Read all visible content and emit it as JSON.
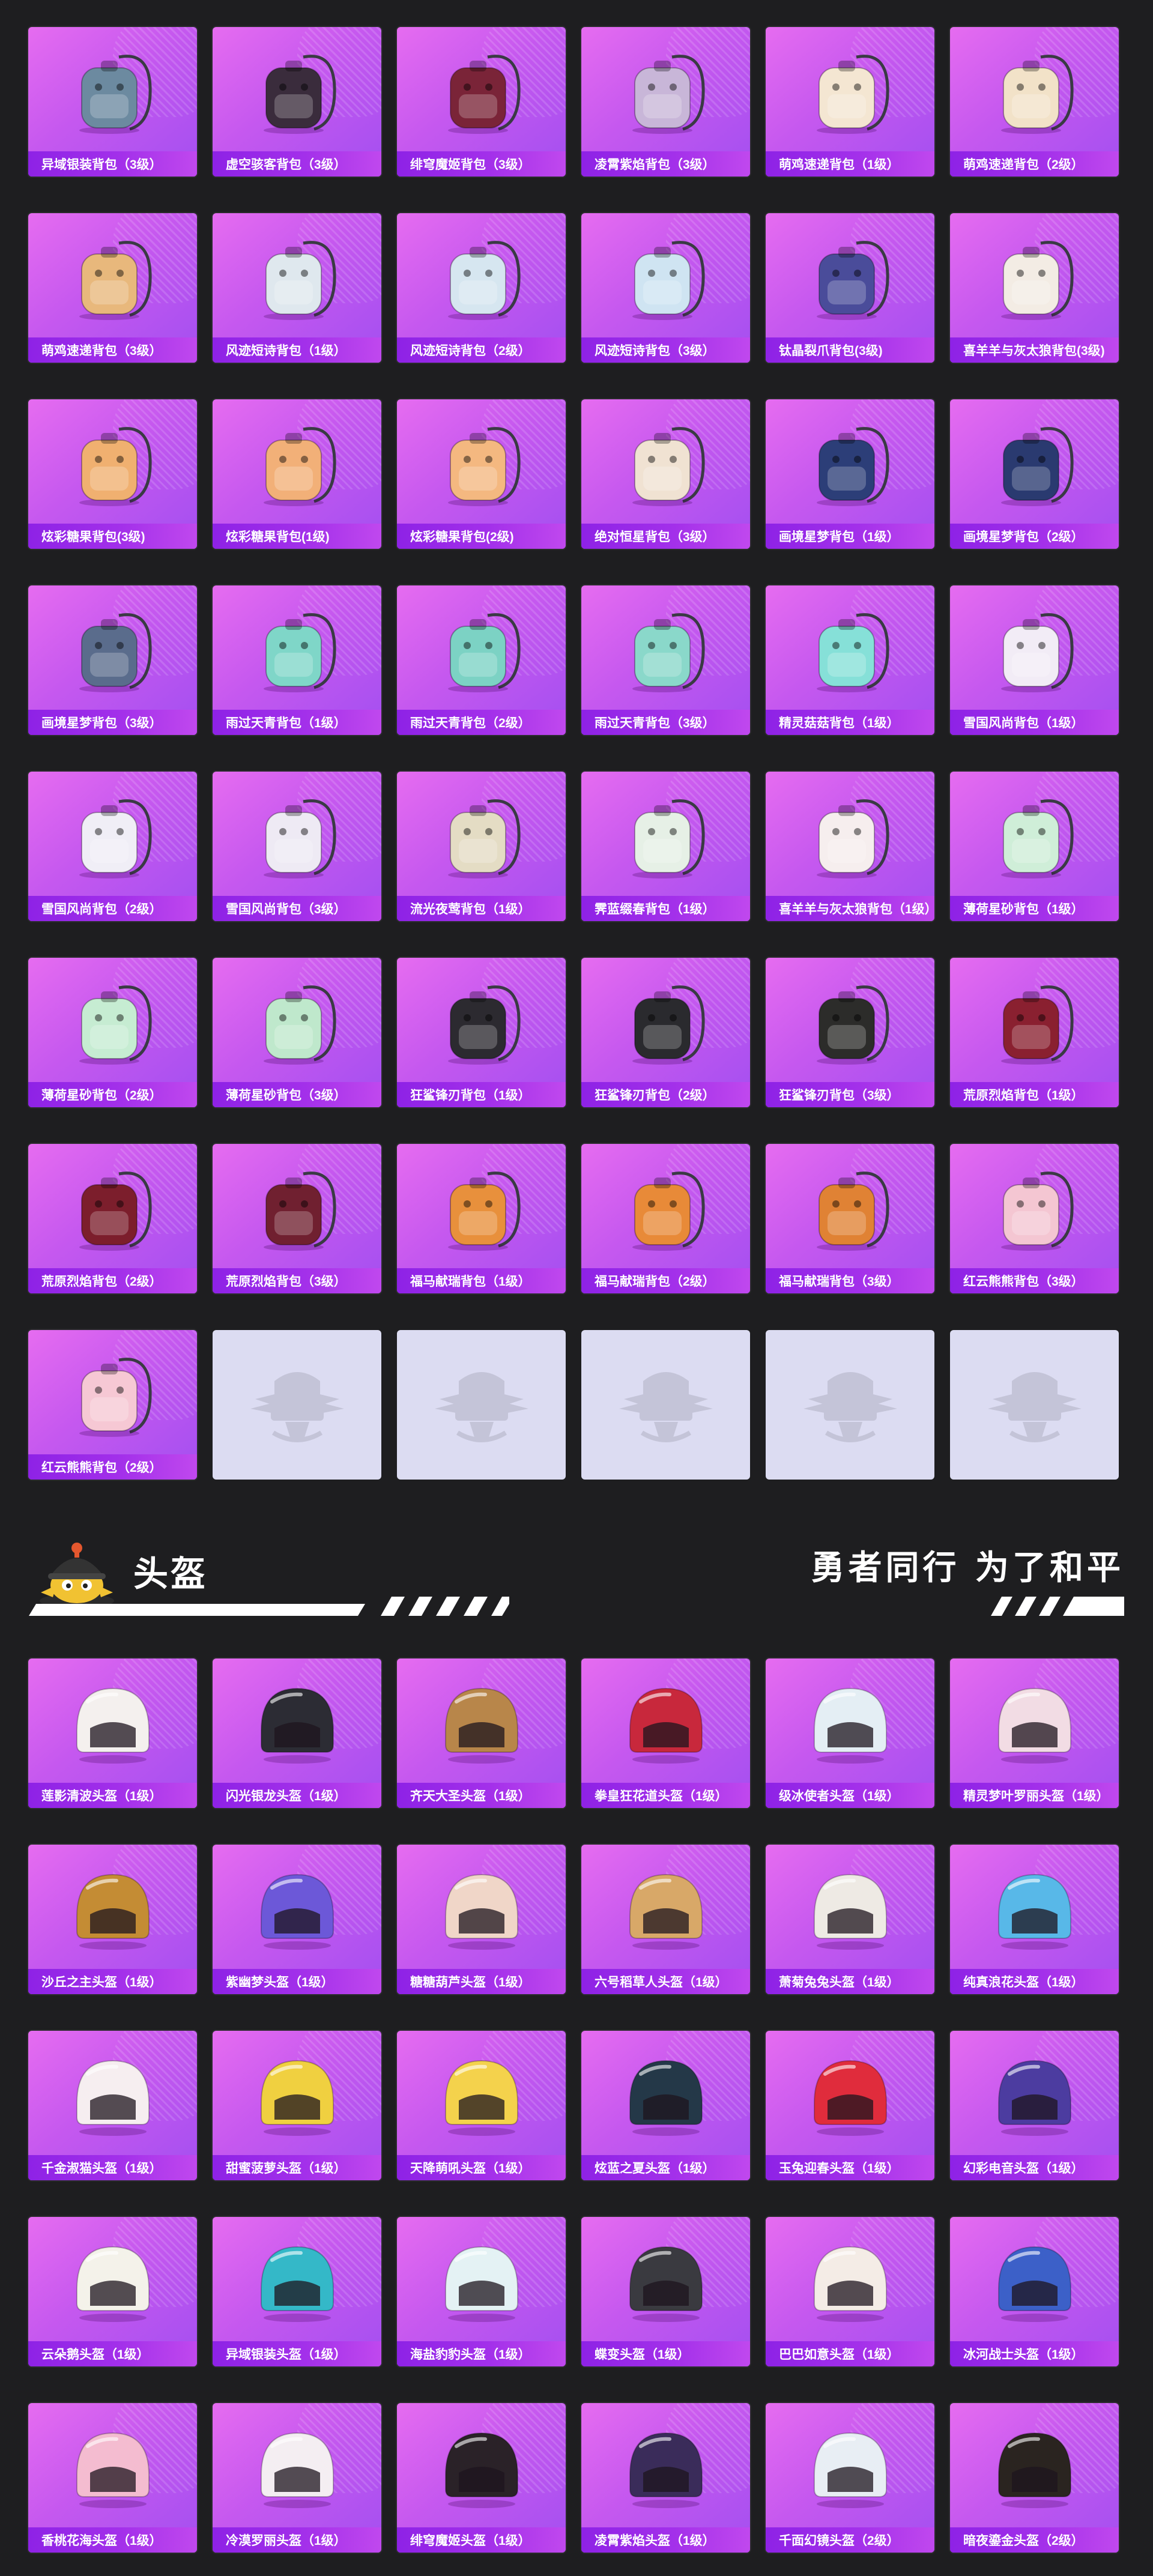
{
  "backpacks": [
    {
      "label": "异域银装背包（3级）",
      "icon": "armored-backpack-icon",
      "color": "#6c8aa0"
    },
    {
      "label": "虚空骇客背包（3级）",
      "icon": "mask-backpack-icon",
      "color": "#3a2c3c"
    },
    {
      "label": "绯穹魔姬背包（3级）",
      "icon": "demon-backpack-icon",
      "color": "#7a2438"
    },
    {
      "label": "凌霄紫焰背包（3级）",
      "icon": "crest-backpack-icon",
      "color": "#c8b6d8"
    },
    {
      "label": "萌鸡速递背包（1级）",
      "icon": "chick-backpack-icon",
      "color": "#f4e6d2"
    },
    {
      "label": "萌鸡速递背包（2级）",
      "icon": "chick-backpack-icon",
      "color": "#f2e2c8"
    },
    {
      "label": "萌鸡速递背包（3级）",
      "icon": "chick-backpack-icon",
      "color": "#e8b87c"
    },
    {
      "label": "风迹短诗背包（1级）",
      "icon": "poem-backpack-icon",
      "color": "#dfe8ee"
    },
    {
      "label": "风迹短诗背包（2级）",
      "icon": "poem-backpack-icon",
      "color": "#d6e6f0"
    },
    {
      "label": "风迹短诗背包（3级）",
      "icon": "poem-backpack-icon",
      "color": "#cfe4f2"
    },
    {
      "label": "钛晶裂爪背包(3级)",
      "icon": "crystal-backpack-icon",
      "color": "#4a4c9a"
    },
    {
      "label": "喜羊羊与灰太狼背包(3级)",
      "icon": "sheep-backpack-icon",
      "color": "#f3ece4"
    },
    {
      "label": "炫彩糖果背包(3级)",
      "icon": "candy-backpack-icon",
      "color": "#f0b070"
    },
    {
      "label": "炫彩糖果背包(1级)",
      "icon": "candy-backpack-icon",
      "color": "#f2b078"
    },
    {
      "label": "炫彩糖果背包(2级)",
      "icon": "candy-backpack-icon",
      "color": "#f4b880"
    },
    {
      "label": "绝对恒星背包（3级）",
      "icon": "popcorn-backpack-icon",
      "color": "#f0e2d2"
    },
    {
      "label": "画境星梦背包（1级）",
      "icon": "book-backpack-icon",
      "color": "#2c3e78"
    },
    {
      "label": "画境星梦背包（2级）",
      "icon": "book-backpack-icon",
      "color": "#2a3a70"
    },
    {
      "label": "画境星梦背包（3级）",
      "icon": "mirror-backpack-icon",
      "color": "#5a6c8c"
    },
    {
      "label": "雨过天青背包（1级）",
      "icon": "bird-backpack-icon",
      "color": "#7fd6c8"
    },
    {
      "label": "雨过天青背包（2级）",
      "icon": "bird-backpack-icon",
      "color": "#7cd2c4"
    },
    {
      "label": "雨过天青背包（3级）",
      "icon": "bird-backpack-icon",
      "color": "#8ad8ca"
    },
    {
      "label": "精灵菇菇背包（1级）",
      "icon": "mushroom-backpack-icon",
      "color": "#86e0d8"
    },
    {
      "label": "雪国风尚背包（1级）",
      "icon": "snow-backpack-icon",
      "color": "#f2ecf6"
    },
    {
      "label": "雪国风尚背包（2级）",
      "icon": "snowman-backpack-icon",
      "color": "#f0eef6"
    },
    {
      "label": "雪国风尚背包（3级）",
      "icon": "snowman-backpack-icon",
      "color": "#eeeaf4"
    },
    {
      "label": "流光夜莺背包（1级）",
      "icon": "pouch-backpack-icon",
      "color": "#e4dcc4"
    },
    {
      "label": "霁蓝缀春背包（1级）",
      "icon": "bunny-backpack-icon",
      "color": "#e6f0e6"
    },
    {
      "label": "喜羊羊与灰太狼背包（1级）",
      "icon": "sheep-backpack-icon",
      "color": "#f6eeee"
    },
    {
      "label": "薄荷星砂背包（1级）",
      "icon": "mint-backpack-icon",
      "color": "#cfeed8"
    },
    {
      "label": "薄荷星砂背包（2级）",
      "icon": "mint-backpack-icon",
      "color": "#c6ecd2"
    },
    {
      "label": "薄荷星砂背包（3级）",
      "icon": "mint-backpack-icon",
      "color": "#bfe8cc"
    },
    {
      "label": "狂鲨锋刃背包（1级）",
      "icon": "shark-backpack-icon",
      "color": "#2c2a30"
    },
    {
      "label": "狂鲨锋刃背包（2级）",
      "icon": "shark-backpack-icon",
      "color": "#2a2a2e"
    },
    {
      "label": "狂鲨锋刃背包（3级）",
      "icon": "shark-backpack-icon",
      "color": "#2c2c2a"
    },
    {
      "label": "荒原烈焰背包（1级）",
      "icon": "flame-backpack-icon",
      "color": "#8a2030"
    },
    {
      "label": "荒原烈焰背包（2级）",
      "icon": "flame-backpack-icon",
      "color": "#7c1e2c"
    },
    {
      "label": "荒原烈焰背包（3级）",
      "icon": "flame-backpack-icon",
      "color": "#702030"
    },
    {
      "label": "福马献瑞背包（1级）",
      "icon": "horse-backpack-icon",
      "color": "#e8903c"
    },
    {
      "label": "福马献瑞背包（2级）",
      "icon": "horse-backpack-icon",
      "color": "#e88a38"
    },
    {
      "label": "福马献瑞背包（3级）",
      "icon": "horse-backpack-icon",
      "color": "#e08234"
    },
    {
      "label": "红云熊熊背包（3级）",
      "icon": "bear-backpack-icon",
      "color": "#f4c6d2"
    },
    {
      "label": "红云熊熊背包（2级）",
      "icon": "bear-backpack-icon",
      "color": "#f6c8d4"
    },
    {
      "label": "",
      "icon": "placeholder-emblem-icon",
      "color": "#c4c4d8",
      "empty": true
    },
    {
      "label": "",
      "icon": "placeholder-emblem-icon",
      "color": "#c4c4d8",
      "empty": true
    },
    {
      "label": "",
      "icon": "placeholder-emblem-icon",
      "color": "#c4c4d8",
      "empty": true
    },
    {
      "label": "",
      "icon": "placeholder-emblem-icon",
      "color": "#c4c4d8",
      "empty": true
    },
    {
      "label": "",
      "icon": "placeholder-emblem-icon",
      "color": "#c4c4d8",
      "empty": true
    }
  ],
  "helmet_section": {
    "title": "头盔",
    "slogan": "勇者同行 为了和平"
  },
  "helmets": [
    {
      "label": "莲影清波头盔（1级）",
      "icon": "helmet-icon",
      "color": "#f4f0ee"
    },
    {
      "label": "闪光银龙头盔（1级）",
      "icon": "helmet-icon",
      "color": "#2c2c34"
    },
    {
      "label": "齐天大圣头盔（1级）",
      "icon": "monkey-king-helmet-icon",
      "color": "#b8864a"
    },
    {
      "label": "拳皇狂花道头盔（1级）",
      "icon": "helmet-icon",
      "color": "#c8283c"
    },
    {
      "label": "级冰使者头盔（1级）",
      "icon": "helmet-icon",
      "color": "#e4eef4"
    },
    {
      "label": "精灵梦叶罗丽头盔（1级）",
      "icon": "helmet-icon",
      "color": "#f2dce4"
    },
    {
      "label": "沙丘之主头盔（1级）",
      "icon": "helmet-icon",
      "color": "#c48c34"
    },
    {
      "label": "紫幽梦头盔（1级）",
      "icon": "helmet-icon",
      "color": "#6c58d8"
    },
    {
      "label": "糖糖葫芦头盔（1级）",
      "icon": "helmet-icon",
      "color": "#f0d6c8"
    },
    {
      "label": "六号稻草人头盔（1级）",
      "icon": "scarecrow-helmet-icon",
      "color": "#d8a868"
    },
    {
      "label": "萧菊兔兔头盔（1级）",
      "icon": "helmet-icon",
      "color": "#eeeae4"
    },
    {
      "label": "纯真浪花头盔（1级）",
      "icon": "helmet-icon",
      "color": "#58b8e8"
    },
    {
      "label": "千金淑猫头盔（1级）",
      "icon": "cat-helmet-icon",
      "color": "#f6eef0"
    },
    {
      "label": "甜蜜菠萝头盔（1级）",
      "icon": "pineapple-helmet-icon",
      "color": "#f0d040"
    },
    {
      "label": "天降萌吼头盔（1级）",
      "icon": "helmet-icon",
      "color": "#f4d24c"
    },
    {
      "label": "炫蓝之夏头盔（1级）",
      "icon": "helmet-icon",
      "color": "#243848"
    },
    {
      "label": "玉兔迎春头盔（1级）",
      "icon": "helmet-icon",
      "color": "#e02c3c"
    },
    {
      "label": "幻彩电音头盔（1级）",
      "icon": "helmet-icon",
      "color": "#4c3ca0"
    },
    {
      "label": "云朵鹅头盔（1级）",
      "icon": "helmet-icon",
      "color": "#f4f2ea"
    },
    {
      "label": "异域银装头盔（1级）",
      "icon": "helmet-icon",
      "color": "#34b8c8"
    },
    {
      "label": "海盐豹豹头盔（1级）",
      "icon": "helmet-icon",
      "color": "#e4f2f4"
    },
    {
      "label": "蝶变头盔（1级）",
      "icon": "helmet-icon",
      "color": "#3a3a40"
    },
    {
      "label": "巴巴如意头盔（1级）",
      "icon": "helmet-icon",
      "color": "#f4ece6"
    },
    {
      "label": "冰河战士头盔（1级）",
      "icon": "helmet-icon",
      "color": "#3c60c8"
    },
    {
      "label": "香桃花海头盔（1级）",
      "icon": "helmet-icon",
      "color": "#f4bcd0"
    },
    {
      "label": "冷漠罗丽头盔（1级）",
      "icon": "helmet-icon",
      "color": "#f4eef2"
    },
    {
      "label": "绯穹魔姬头盔（1级）",
      "icon": "helmet-icon",
      "color": "#2a2228"
    },
    {
      "label": "凌霄紫焰头盔（1级）",
      "icon": "helmet-icon",
      "color": "#3a2c5a"
    },
    {
      "label": "千面幻镜头盔（2级）",
      "icon": "helmet-icon",
      "color": "#e8eef4"
    },
    {
      "label": "暗夜鎏金头盔（2级）",
      "icon": "helmet-icon",
      "color": "#2a2420"
    }
  ]
}
